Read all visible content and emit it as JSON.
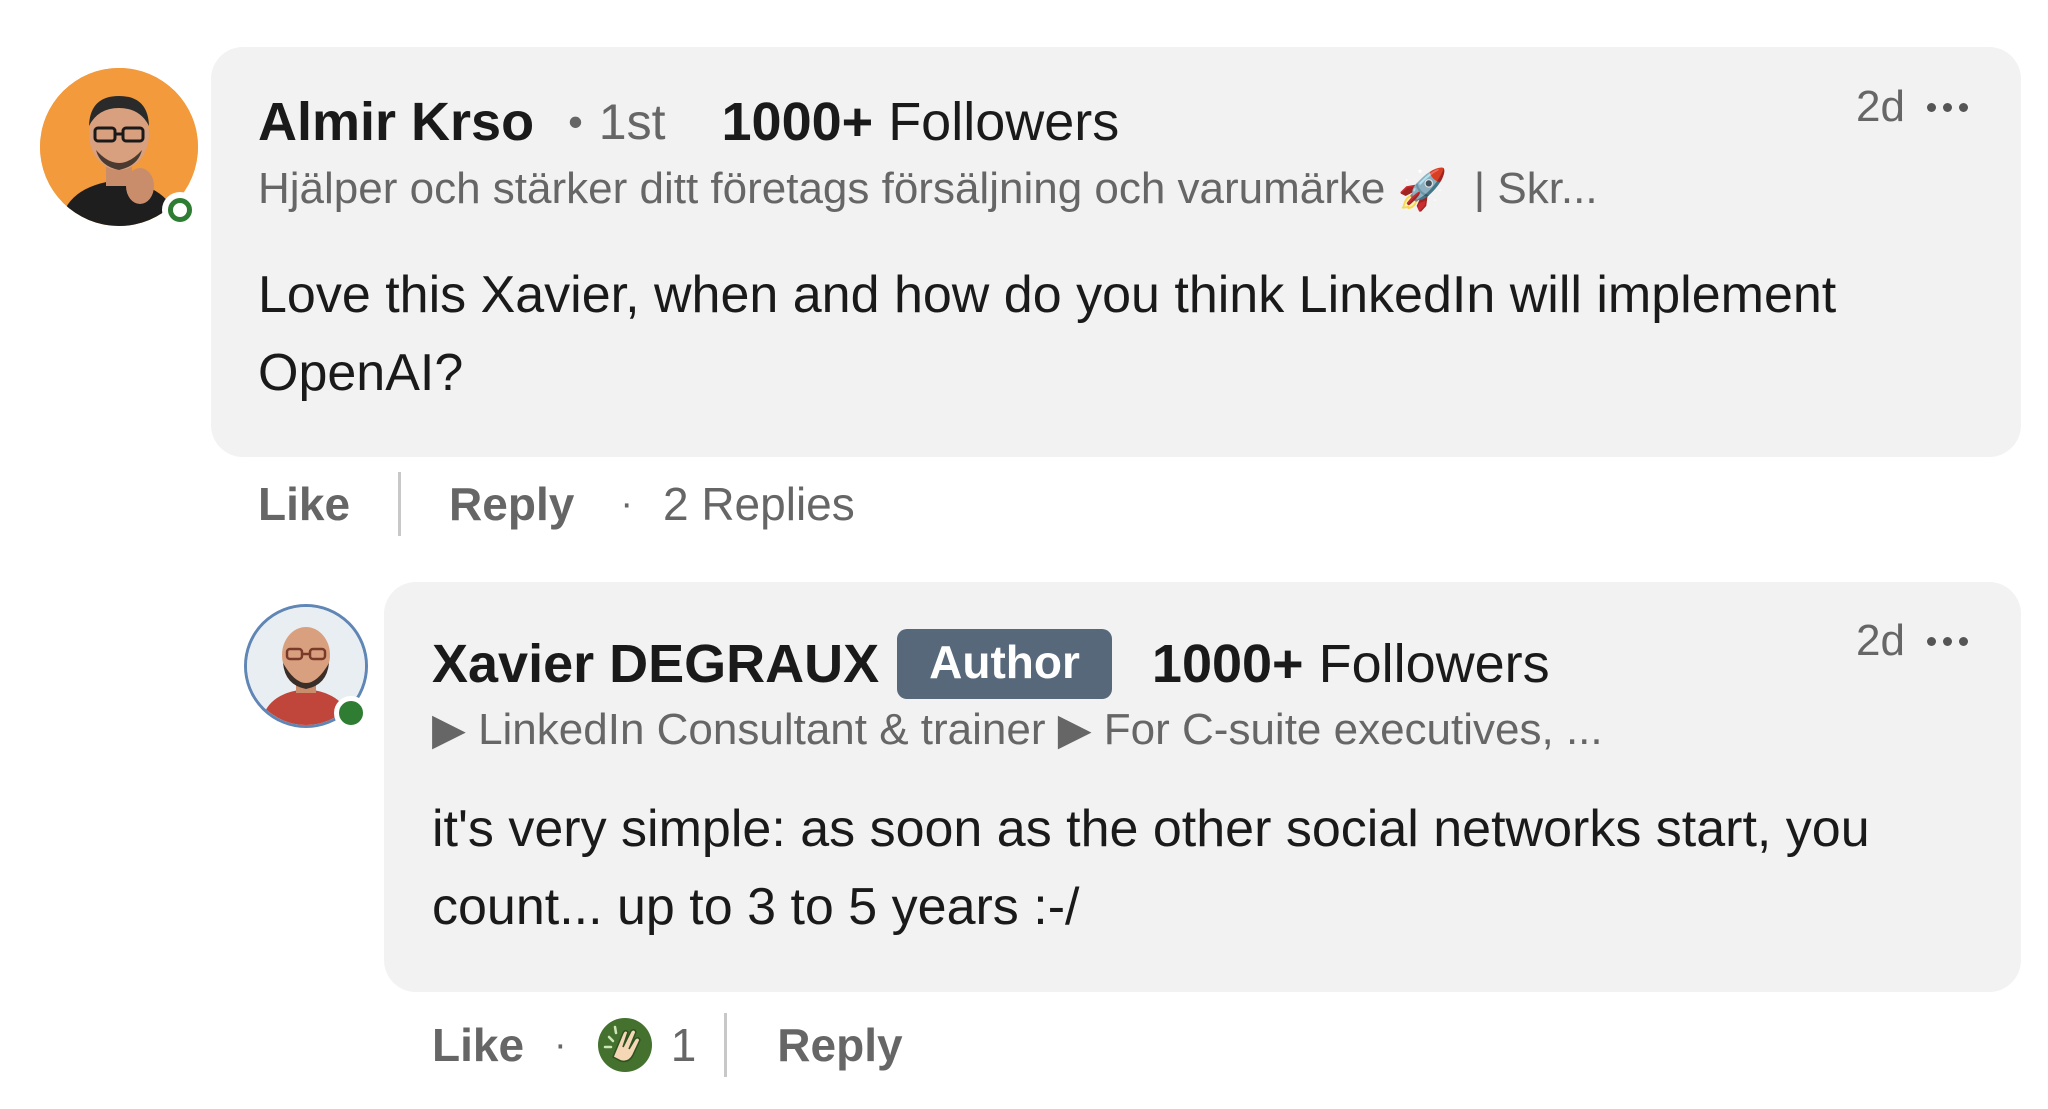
{
  "comments": [
    {
      "author": "Almir Krso",
      "degree": "1st",
      "followers_count": "1000+",
      "followers_label": "Followers",
      "headline_text": "Hjälper och stärker ditt företags försäljning och varumärke",
      "headline_emoji": "🚀",
      "headline_tail": "| Skr...",
      "time": "2d",
      "body": "Love this Xavier, when and how do you think LinkedIn will implement OpenAI?",
      "actions": {
        "like": "Like",
        "reply": "Reply",
        "replies": "2 Replies"
      },
      "avatar_bg": "#f29a3c",
      "presence_color": "#2e7d32"
    }
  ],
  "reply": {
    "author": "Xavier DEGRAUX",
    "badge": "Author",
    "followers_count": "1000+",
    "followers_label": "Followers",
    "headline": "▶ LinkedIn Consultant & trainer ▶ For C-suite executives, ...",
    "time": "2d",
    "body": "it's very simple: as soon as the other social networks start, you count... up to 3 to 5 years :-/",
    "actions": {
      "like": "Like",
      "reaction_count": "1",
      "reply": "Reply"
    },
    "reaction_icon": "clap-icon",
    "presence_color": "#2e7d32"
  },
  "colors": {
    "bubble": "#f2f2f2",
    "badge": "#56687a",
    "muted": "#666666"
  }
}
